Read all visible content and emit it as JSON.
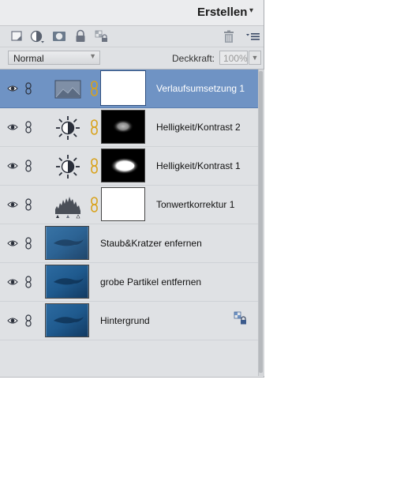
{
  "panel": {
    "title": "Erstellen",
    "title_chevron": "▾"
  },
  "toolbar": {
    "icons": [
      "new-layer-icon",
      "adjustment-layer-icon",
      "layer-mask-icon",
      "lock-icon",
      "lock-transparency-icon",
      "trash-icon",
      "panel-menu-icon"
    ]
  },
  "options": {
    "blend_mode": "Normal",
    "opacity_label": "Deckkraft:",
    "opacity_value": "100%"
  },
  "layers": [
    {
      "name": "Verlaufsumsetzung 1",
      "type": "gradient-map",
      "selected": true
    },
    {
      "name": "Helligkeit/Kontrast 2",
      "type": "brightness-contrast",
      "selected": false
    },
    {
      "name": "Helligkeit/Kontrast 1",
      "type": "brightness-contrast",
      "selected": false
    },
    {
      "name": "Tonwertkorrektur 1",
      "type": "levels",
      "selected": false
    },
    {
      "name": "Staub&Kratzer enfernen",
      "type": "image",
      "selected": false
    },
    {
      "name": "grobe Partikel entfernen",
      "type": "image",
      "selected": false
    },
    {
      "name": "Hintergrund",
      "type": "image",
      "selected": false,
      "locked": true
    }
  ],
  "colors": {
    "selection": "#6f93c4",
    "panel_bg": "#dfe1e4",
    "link_orange": "#d9a21b"
  }
}
